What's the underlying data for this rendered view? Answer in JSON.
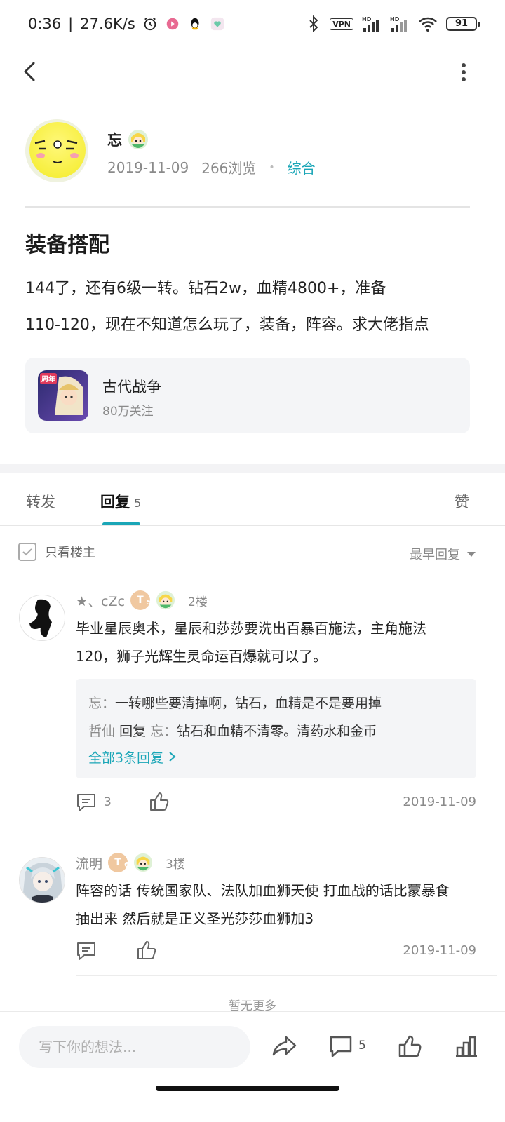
{
  "status_bar": {
    "time": "0:36",
    "net_speed": "27.6K/s",
    "vpn": "VPN",
    "hd": "HD",
    "battery": "91"
  },
  "author": {
    "name": "忘",
    "date": "2019-11-09",
    "views": "266浏览",
    "category": "综合"
  },
  "post": {
    "title": "装备搭配",
    "body_line1": "144了，还有6级一转。钻石2w，血精4800+，准备",
    "body_line2": "110-120，现在不知道怎么玩了，装备，阵容。求大佬指点"
  },
  "game": {
    "name": "古代战争",
    "followers": "80万关注",
    "icon_text": "周年"
  },
  "tabs": {
    "forward": "转发",
    "reply": "回复",
    "reply_count": "5",
    "like": "赞"
  },
  "filter": {
    "only_op": "只看楼主",
    "sort": "最早回复"
  },
  "comments": [
    {
      "name": "★、cZc",
      "badge_letter": "T",
      "badge_level": "5",
      "floor": "2楼",
      "text_line1": "毕业星辰奥术，星辰和莎莎要洗出百暴百施法，主角施法",
      "text_line2": "120，狮子光辉生灵命运百爆就可以了。",
      "replies": [
        {
          "name": "忘",
          "text": "一转哪些要清掉啊，钻石，血精是不是要用掉"
        },
        {
          "name": "哲仙",
          "reply_word": "回复",
          "target": "忘",
          "text": "钻石和血精不清零。清药水和金币"
        }
      ],
      "all_replies": "全部3条回复",
      "comment_count": "3",
      "date": "2019-11-09"
    },
    {
      "name": "流明",
      "badge_letter": "T",
      "badge_level": "6",
      "floor": "3楼",
      "text_line1": "阵容的话 传统国家队、法队加血狮天使 打血战的话比蒙暴食",
      "text_line2": "抽出来 然后就是正义圣光莎莎血狮加3",
      "date": "2019-11-09"
    }
  ],
  "no_more": "暂无更多",
  "bottom": {
    "placeholder": "写下你的想法...",
    "comment_count": "5"
  },
  "colors": {
    "accent": "#1aa6b7",
    "muted": "#8a8a8a",
    "card_bg": "#f4f5f7"
  }
}
